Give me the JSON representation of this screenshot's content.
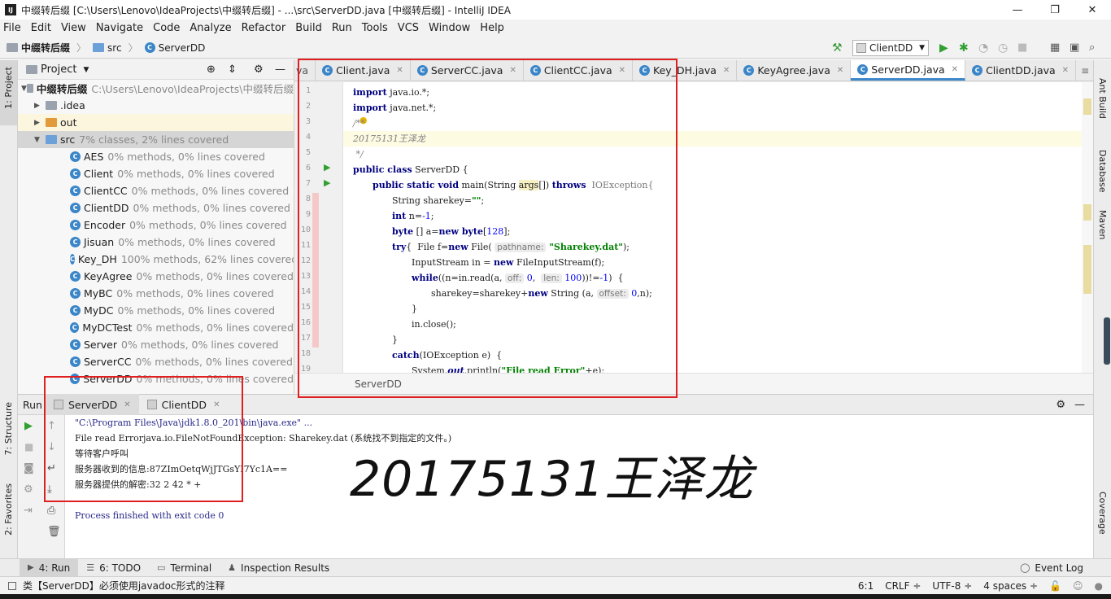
{
  "window": {
    "title": "中缀转后缀 [C:\\Users\\Lenovo\\IdeaProjects\\中缀转后缀] - ...\\src\\ServerDD.java [中缀转后缀] - IntelliJ IDEA",
    "logo": "IJ"
  },
  "menu": [
    "File",
    "Edit",
    "View",
    "Navigate",
    "Code",
    "Analyze",
    "Refactor",
    "Build",
    "Run",
    "Tools",
    "VCS",
    "Window",
    "Help"
  ],
  "nav": {
    "project": "中缀转后缀",
    "src": "src",
    "file": "ServerDD",
    "run_config": "ClientDD"
  },
  "left_strip": {
    "project_tab": "1: Project",
    "structure_tab": "7: Structure",
    "favorites_tab": "2: Favorites"
  },
  "right_strip": {
    "ant": "Ant Build",
    "database": "Database",
    "maven": "Maven",
    "coverage": "Coverage"
  },
  "project_panel": {
    "title": "Project",
    "root": {
      "name": "中缀转后缀",
      "path": "C:\\Users\\Lenovo\\IdeaProjects\\中缀转后缀"
    },
    "idea": ".idea",
    "out": "out",
    "src": {
      "name": "src",
      "coverage": "7% classes, 2% lines covered"
    },
    "classes": [
      {
        "name": "AES",
        "coverage": "0% methods, 0% lines covered"
      },
      {
        "name": "Client",
        "coverage": "0% methods, 0% lines covered"
      },
      {
        "name": "ClientCC",
        "coverage": "0% methods, 0% lines covered"
      },
      {
        "name": "ClientDD",
        "coverage": "0% methods, 0% lines covered"
      },
      {
        "name": "Encoder",
        "coverage": "0% methods, 0% lines covered"
      },
      {
        "name": "Jisuan",
        "coverage": "0% methods, 0% lines covered"
      },
      {
        "name": "Key_DH",
        "coverage": "100% methods, 62% lines covered"
      },
      {
        "name": "KeyAgree",
        "coverage": "0% methods, 0% lines covered"
      },
      {
        "name": "MyBC",
        "coverage": "0% methods, 0% lines covered"
      },
      {
        "name": "MyDC",
        "coverage": "0% methods, 0% lines covered"
      },
      {
        "name": "MyDCTest",
        "coverage": "0% methods, 0% lines covered"
      },
      {
        "name": "Server",
        "coverage": "0% methods, 0% lines covered"
      },
      {
        "name": "ServerCC",
        "coverage": "0% methods, 0% lines covered"
      },
      {
        "name": "ServerDD",
        "coverage": "0% methods, 0% lines covered"
      }
    ]
  },
  "editor_tabs": [
    "va",
    "Client.java",
    "ServerCC.java",
    "ClientCC.java",
    "Key_DH.java",
    "KeyAgree.java",
    "ServerDD.java",
    "ClientDD.java"
  ],
  "active_tab": "ServerDD.java",
  "code": {
    "l1_kw": "import",
    "l1": " java.io.*;",
    "l2_kw": "import",
    "l2": " java.net.*;",
    "l3": "/**",
    "l4": "20175131王泽龙",
    "l5": " */",
    "l6_kw": "public class",
    "l6": " ServerDD {",
    "l7_kw": "public static void",
    "l7a": " main(String ",
    "l7b": "args",
    "l7c": "[]) ",
    "l7_kw2": "throws",
    "l7d": "  IOException{",
    "l8a": "String sharekey=",
    "l8s": "\"\"",
    "l8b": ";",
    "l9_kw": "int",
    "l9a": " n=",
    "l9n": "-1",
    "l9b": ";",
    "l10_kw": "byte",
    "l10a": " [] a=",
    "l10_kw2": "new byte",
    "l10b": "[",
    "l10n": "128",
    "l10c": "];",
    "l11_kw": "try",
    "l11a": "{  File f=",
    "l11_kw2": "new",
    "l11b": " File( ",
    "l11h": "pathname:",
    "l11s": " \"Sharekey.dat\"",
    "l11c": ");",
    "l12a": "InputStream in = ",
    "l12_kw": "new",
    "l12b": " FileInputStream(f);",
    "l13_kw": "while",
    "l13a": "((n=in.read(a, ",
    "l13h1": "off:",
    "l13n1": " 0",
    "l13b": ",  ",
    "l13h2": "len:",
    "l13n2": " 100",
    "l13c": "))!=",
    "l13n3": "-1",
    "l13d": ")  {",
    "l14a": "sharekey=sharekey+",
    "l14_kw": "new",
    "l14b": " String (a, ",
    "l14h": "offset:",
    "l14n": " 0",
    "l14c": ",n);",
    "l15": "}",
    "l16": "in.close();",
    "l17": "}",
    "l18_kw": "catch",
    "l18": "(IOException e)  {",
    "l19a": "System.",
    "l19b": "out",
    "l19c": ".println(",
    "l19s": "\"File read Error\"",
    "l19d": "+e);"
  },
  "line_numbers": [
    "1",
    "2",
    "3",
    "4",
    "5",
    "6",
    "7",
    "8",
    "9",
    "10",
    "11",
    "12",
    "13",
    "14",
    "15",
    "16",
    "17",
    "18",
    "19"
  ],
  "editor_footer": "ServerDD",
  "run_panel": {
    "label": "Run",
    "tabs": [
      "ServerDD",
      "ClientDD"
    ],
    "console": [
      "\"C:\\Program Files\\Java\\jdk1.8.0_201\\bin\\java.exe\" ...",
      "File read Errorjava.io.FileNotFoundException: Sharekey.dat (系统找不到指定的文件。)",
      "等待客户呼叫",
      "服务器收到的信息:87ZImOetqWjJTGsYI7Yc1A==",
      "服务器提供的解密:32 2 42 * +",
      "",
      "Process finished with exit code 0"
    ],
    "watermark": "20175131王泽龙"
  },
  "bottom_tabs": [
    "4: Run",
    "6: TODO",
    "Terminal",
    "Inspection Results"
  ],
  "event_log": "Event Log",
  "status": {
    "message": "类【ServerDD】必须使用javadoc形式的注释",
    "position": "6:1",
    "line_sep": "CRLF ÷",
    "encoding": "UTF-8 ÷",
    "indent": "4 spaces ÷"
  }
}
